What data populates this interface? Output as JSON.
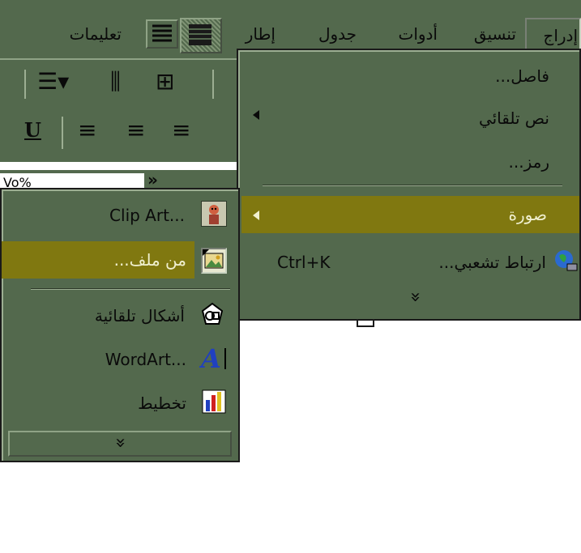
{
  "menubar": {
    "items": [
      "تعليمات",
      "إطار",
      "جدول",
      "أدوات",
      "تنسيق",
      "إدراج"
    ]
  },
  "toolbar": {
    "ruler_value": "Vo%"
  },
  "insert_menu": {
    "items": [
      {
        "label": "فاصل...",
        "shortcut": "",
        "submenu": false
      },
      {
        "label": "نص تلقائي",
        "shortcut": "",
        "submenu": true
      },
      {
        "label": "رمز...",
        "shortcut": "",
        "submenu": false
      },
      {
        "label": "صورة",
        "shortcut": "",
        "submenu": true,
        "highlighted": true
      },
      {
        "label": "ارتباط تشعبي...",
        "shortcut": "Ctrl+K",
        "submenu": false
      }
    ],
    "expand_glyph": "»"
  },
  "picture_menu": {
    "items": [
      {
        "label": "Clip Art...",
        "icon": "clipart-icon"
      },
      {
        "label": "من ملف...",
        "icon": "from-file-icon",
        "highlighted": true
      },
      {
        "label": "أشكال تلقائية",
        "icon": "autoshapes-icon"
      },
      {
        "label": "WordArt...",
        "icon": "wordart-icon"
      },
      {
        "label": "تخطيط",
        "icon": "chart-icon"
      }
    ],
    "expand_glyph": "»"
  },
  "colors": {
    "menu_bg": "#53694d",
    "highlight": "#807810",
    "highlight_text": "#f0f0d0"
  }
}
